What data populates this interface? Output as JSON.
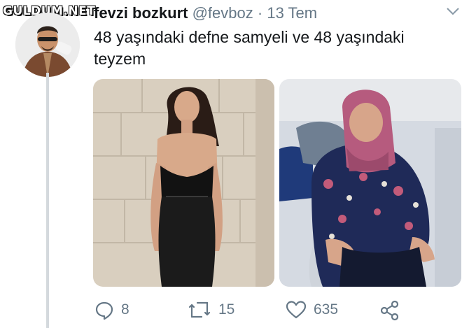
{
  "watermark": "GULDUM.NET",
  "tweet": {
    "name": "fevzi bozkurt",
    "handle": "@fevboz",
    "separator": "·",
    "time": "13 Tem",
    "text": "48 yaşındaki defne samyeli ve 48 yaşındaki teyzem"
  },
  "icons": {
    "more": "chevron-down-icon",
    "reply": "reply-icon",
    "retweet": "retweet-icon",
    "like": "heart-icon",
    "share": "share-icon"
  },
  "actions": {
    "replies": "8",
    "retweets": "15",
    "likes": "635"
  },
  "colors": {
    "text": "#14171a",
    "muted": "#657786",
    "thread_line": "#d4d9dd"
  }
}
